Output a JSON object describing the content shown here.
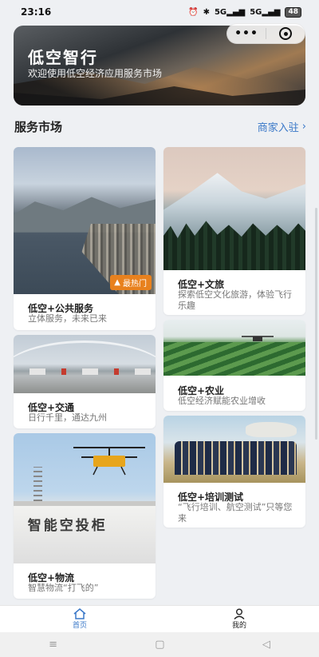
{
  "status_bar": {
    "time": "23:16",
    "signal1": "5G",
    "signal2": "5G",
    "battery": "48"
  },
  "banner": {
    "title": "低空智行",
    "subtitle": "欢迎使用低空经济应用服务市场"
  },
  "capsule": {
    "more": "•••"
  },
  "section": {
    "title": "服务市场",
    "merchant_link": "商家入驻",
    "chevron": "›"
  },
  "cards": [
    {
      "title": "低空+公共服务",
      "desc": "立体服务，未来已来",
      "badge": "最热门"
    },
    {
      "title": "低空+文旅",
      "desc": "探索低空文化旅游，体验飞行乐趣"
    },
    {
      "title": "低空+交通",
      "desc": "日行千里，通达九州"
    },
    {
      "title": "低空+农业",
      "desc": "低空经济赋能农业增收"
    },
    {
      "title": "低空+培训测试",
      "desc": "“飞行培训、航空测试”只等您来"
    },
    {
      "title": "低空+物流",
      "desc": "智慧物流“打飞的”",
      "image_text": "智能空投柜"
    }
  ],
  "tabbar": {
    "home": "首页",
    "mine": "我的"
  },
  "system_nav": {
    "menu": "≡",
    "home": "▢",
    "back": "◁"
  },
  "colors": {
    "accent": "#3a78c8",
    "badge": "#e8811e",
    "background": "#eef0f3"
  }
}
